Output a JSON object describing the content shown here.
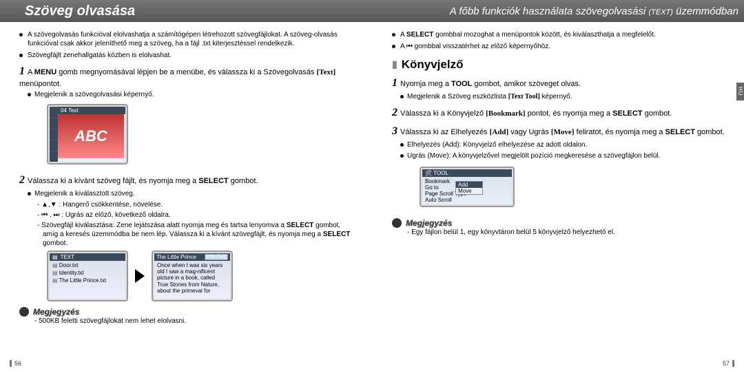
{
  "header": {
    "left_title": "Szöveg olvasása",
    "right_title_a": "A főbb funkciók használata szövegolvasási",
    "right_title_small": "(TEXT)",
    "right_title_b": "üzemmódban"
  },
  "side_tab": "HU",
  "left_page": {
    "intro_bullets": [
      "A szövegolvasás funkcióval elolvashatja a számítógépen létrehozott szövegfájlokat. A szöveg-olvasás funkcióval csak akkor jeleníthető meg a szöveg, ha a fájl .txt kiterjesztéssel rendelkezik.",
      "Szövegfájlt zenehallgatás közben is elolvashat."
    ],
    "step1_pre": "A ",
    "step1_menu": "MENU",
    "step1_post_a": " gomb megnyomásával lépjen be a menübe, és válassza ki a Szövegolvasás ",
    "step1_text_label": "[Text]",
    "step1_post_b": " menüpontot.",
    "step1_sub": "Megjelenik a szövegolvasási képernyő.",
    "abc_screen_title": "04 Text",
    "abc_label": "ABC",
    "step2_pre": "Válassza ki a kívánt szöveg fájlt, és nyomja meg a ",
    "step2_select": "SELECT",
    "step2_post": " gombot.",
    "step2_sub": "Megjelenik a kiválasztott szöveg.",
    "step2_dashes": [
      "▲,▼ : Hangerő csökkentése, növelése.",
      "⏮ , ⏭ : Ugrás az előző, következő oldalra.",
      "Szövegfájl kiválasztása: Zene lejátszása alatt nyomja meg és tartsa lenyomva a SELECT gombot, amíg a keresés üzemmódba be nem lép. Válassza ki a kívánt szövegfájlt, és nyomja meg a SELECT gombot."
    ],
    "dev_left_head": "TEXT",
    "dev_left_items": [
      "Door.txt",
      "Identity.txt",
      "The Little Prince.txt"
    ],
    "dev_right_head": "The Little Prince",
    "dev_right_counter": "0011 /0102",
    "dev_right_body": "Once when I was six years old I saw a mag-nificent picture in a book, called True Stories from Nature, about the primeval for",
    "note_title": "Megjegyzés",
    "note_items": [
      "500KB feletti szövegfájlokat nem lehet elolvasni."
    ],
    "page_number": "56"
  },
  "right_page": {
    "intro_bullets_parts": {
      "b1_pre": "A ",
      "b1_sel": "SELECT",
      "b1_post": " gombbal mozoghat a menüpontok között, és kiválaszthatja a megfelelőt.",
      "b2": "A ⏮ gombbal visszatérhet az előző képernyőhöz."
    },
    "section_title": "Könyvjelző",
    "step1_pre": "Nyomja meg a ",
    "step1_tool": "TOOL",
    "step1_post": " gombot, amikor szöveget olvas.",
    "step1_sub_pre": "Megjelenik a Szöveg eszközlista ",
    "step1_sub_label": "[Text Tool]",
    "step1_sub_post": " képernyő.",
    "step2_pre": "Válassza ki a Könyvjelző ",
    "step2_label": "[Bookmark]",
    "step2_mid": " pontot, és nyomja meg a ",
    "step2_select": "SELECT",
    "step2_post": " gombot.",
    "step3_pre": "Válassza ki az Elhelyezés ",
    "step3_add": "[Add]",
    "step3_mid": " vagy Ugrás ",
    "step3_move": "[Move]",
    "step3_post_a": " feliratot, és nyomja meg a ",
    "step3_select": "SELECT",
    "step3_post_b": " gombot.",
    "step3_subs": [
      "Elhelyezés (Add): Könyvjelző elhelyezése az adott oldalon.",
      "Ugrás (Move): A könyvjelzővel megjelölt pozíció megkeresése a szövegfájlon belül."
    ],
    "tool_head_icon": "🛠",
    "tool_head": "TOOL",
    "tool_items": [
      "Bookmark",
      "Go to",
      "Page Scroll Type",
      "Auto Scroll"
    ],
    "tool_popup": [
      "Add",
      "Move"
    ],
    "note_title": "Megjegyzés",
    "note_items": [
      "Egy fájlon belül 1, egy könyvtáron belül 5 könyvjelző helyezhető el."
    ],
    "page_number": "57"
  }
}
